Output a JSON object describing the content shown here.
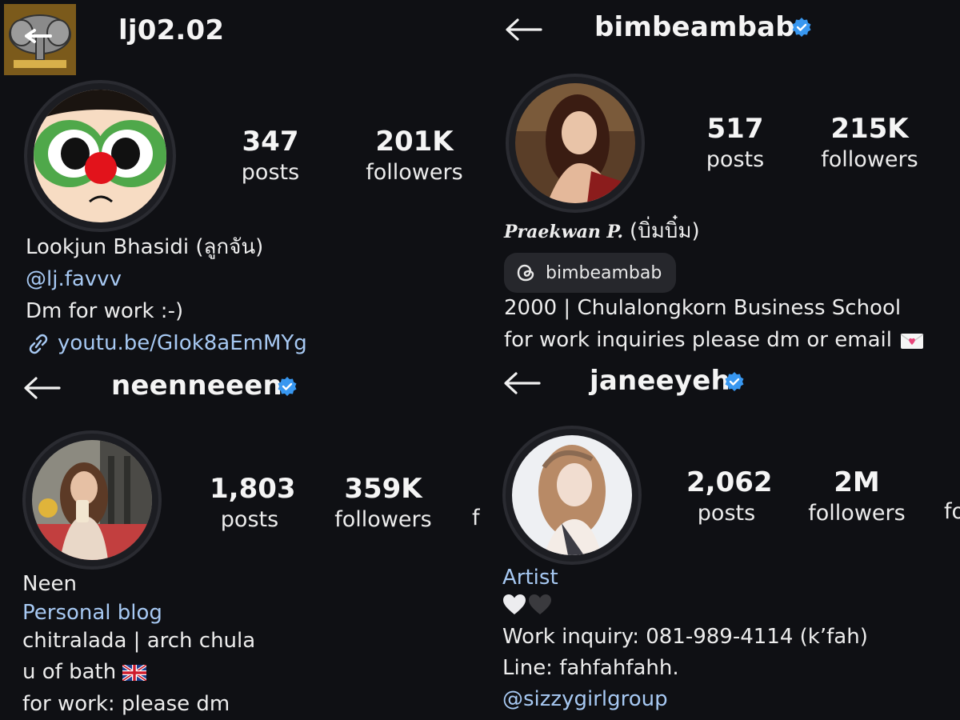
{
  "panels": [
    {
      "username": "lj02.02",
      "stats": [
        {
          "value": "347",
          "label": "posts"
        },
        {
          "value": "201K",
          "label": "followers"
        }
      ],
      "bio": {
        "name": "Lookjun Bhasidi (ลูกจัน)",
        "mention": "@lj.favvv",
        "line": "Dm for work :-)",
        "url": "youtu.be/GIok8aEmMYg"
      },
      "icons": [
        "logo-icon",
        "link-icon"
      ]
    },
    {
      "username": "bimbeambab",
      "verified": true,
      "stats": [
        {
          "value": "517",
          "label": "posts"
        },
        {
          "value": "215K",
          "label": "followers"
        }
      ],
      "bio": {
        "name_script": "Praekwan P.",
        "name_thai": "(บิ่มบิ๋ม)",
        "threads_handle": "bimbeambab",
        "line1": "2000 | Chulalongkorn Business School",
        "line2": "for work inquiries please dm or email"
      },
      "icons": [
        "back-arrow-icon",
        "verified-icon",
        "threads-icon",
        "love-letter-icon"
      ]
    },
    {
      "username": "neenneeen",
      "verified": true,
      "stats": [
        {
          "value": "1,803",
          "label": "posts"
        },
        {
          "value": "359K",
          "label": "followers"
        }
      ],
      "cutoff_label": "f",
      "bio": {
        "name": "Neen",
        "category": "Personal blog",
        "line1": "chitralada | arch chula",
        "line2": "u of bath",
        "line3": "for work: please dm"
      },
      "icons": [
        "back-arrow-icon",
        "verified-icon",
        "uk-flag-icon"
      ]
    },
    {
      "username": "janeeyeh",
      "verified": true,
      "stats": [
        {
          "value": "2,062",
          "label": "posts"
        },
        {
          "value": "2M",
          "label": "followers"
        }
      ],
      "cutoff_label": "fo",
      "bio": {
        "category": "Artist",
        "line1": "Work inquiry: 081-989-4114 (k’fah)",
        "line2": "Line: fahfahfahh.",
        "mention": "@sizzygirlgroup"
      },
      "icons": [
        "back-arrow-icon",
        "verified-icon",
        "white-heart-icon",
        "black-heart-icon"
      ]
    }
  ],
  "colors": {
    "background": "#0f1014",
    "text": "#f3f3f3",
    "link": "#a7c9f3",
    "verified": "#3897f0",
    "chip": "#26272c"
  }
}
